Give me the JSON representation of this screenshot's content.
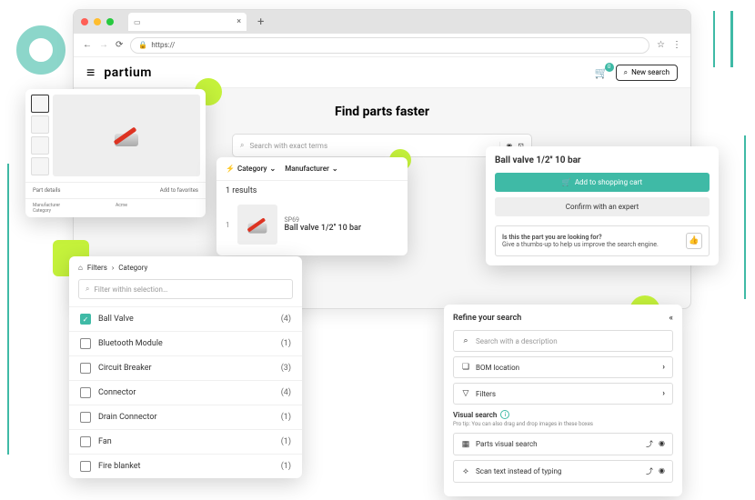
{
  "browser": {
    "url_prefix": "https://",
    "traffic_lights": [
      "#ff5f56",
      "#ffbd2e",
      "#27c93f"
    ]
  },
  "header": {
    "brand": "partium",
    "cart_count": "0",
    "new_search": "New search"
  },
  "hero": {
    "title": "Find parts faster",
    "search_placeholder": "Search with exact terms"
  },
  "details": {
    "section_title": "Part details",
    "add_fav": "Add to favorites",
    "rows": [
      {
        "k": "Manufacturer",
        "v": "Acme"
      },
      {
        "k": "Category",
        "v": ""
      }
    ]
  },
  "results": {
    "filters": [
      {
        "icon": "⚡",
        "label": "Category"
      },
      {
        "icon": "",
        "label": "Manufacturer"
      }
    ],
    "count": "1 results",
    "items": [
      {
        "idx": "1",
        "code": "SP69",
        "name": "Ball valve 1/2'' 10 bar"
      }
    ]
  },
  "product": {
    "title": "Ball valve 1/2'' 10 bar",
    "add_cart": "Add to shopping cart",
    "confirm": "Confirm with an expert",
    "feedback_q": "Is this the part you are looking for?",
    "feedback_h": "Give a thumbs-up to help us improve the search engine."
  },
  "filters": {
    "crumb_home": "⌂",
    "crumb1": "Filters",
    "crumb2": "Category",
    "search_placeholder": "Filter within selection…",
    "items": [
      {
        "label": "Ball Valve",
        "count": "(4)",
        "checked": true
      },
      {
        "label": "Bluetooth Module",
        "count": "(1)",
        "checked": false
      },
      {
        "label": "Circuit Breaker",
        "count": "(3)",
        "checked": false
      },
      {
        "label": "Connector",
        "count": "(4)",
        "checked": false
      },
      {
        "label": "Drain Connector",
        "count": "(1)",
        "checked": false
      },
      {
        "label": "Fan",
        "count": "(1)",
        "checked": false
      },
      {
        "label": "Fire blanket",
        "count": "(1)",
        "checked": false
      }
    ]
  },
  "refine": {
    "title": "Refine your search",
    "desc_placeholder": "Search with a description",
    "bom": "BOM location",
    "filters": "Filters",
    "visual_title": "Visual search",
    "visual_tip": "Pro tip: You can also drag and drop images in these boxes",
    "parts_visual": "Parts visual search",
    "scan_text": "Scan text instead of typing"
  }
}
